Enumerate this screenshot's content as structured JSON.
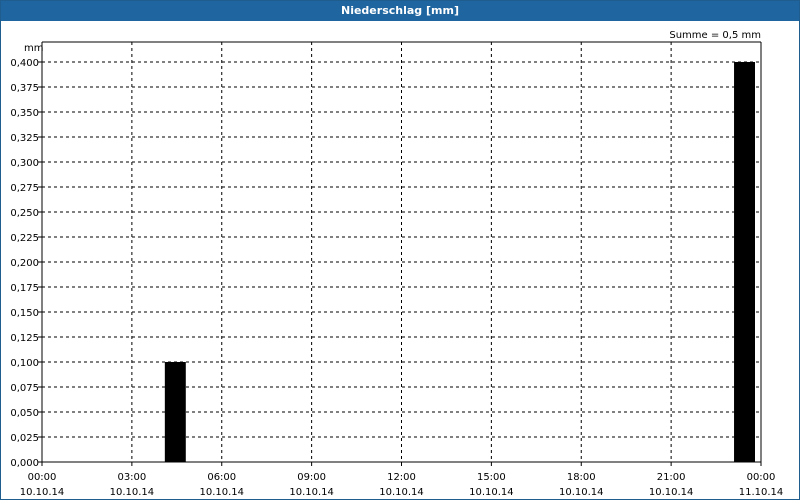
{
  "window": {
    "title": "Niederschlag [mm]"
  },
  "chart_data": {
    "type": "bar",
    "title": "Niederschlag [mm]",
    "ylabel": "mm",
    "annotation": "Summe = 0,5 mm",
    "ylim": [
      0,
      0.4
    ],
    "grid": true,
    "y_ticks": [
      "0,000",
      "0,025",
      "0,050",
      "0,075",
      "0,100",
      "0,125",
      "0,150",
      "0,175",
      "0,200",
      "0,225",
      "0,250",
      "0,275",
      "0,300",
      "0,325",
      "0,350",
      "0,375",
      "0,400"
    ],
    "x_ticks": [
      {
        "time": "00:00",
        "date": "10.10.14"
      },
      {
        "time": "03:00",
        "date": "10.10.14"
      },
      {
        "time": "06:00",
        "date": "10.10.14"
      },
      {
        "time": "09:00",
        "date": "10.10.14"
      },
      {
        "time": "12:00",
        "date": "10.10.14"
      },
      {
        "time": "15:00",
        "date": "10.10.14"
      },
      {
        "time": "18:00",
        "date": "10.10.14"
      },
      {
        "time": "21:00",
        "date": "10.10.14"
      },
      {
        "time": "00:00",
        "date": "11.10.14"
      }
    ],
    "xlim": [
      "10.10.14 00:00",
      "11.10.14 00:00"
    ],
    "bars": [
      {
        "start": "10.10.14 04:00",
        "end": "10.10.14 05:00",
        "value": 0.1
      },
      {
        "start": "10.10.14 23:00",
        "end": "11.10.14 00:00",
        "value": 0.4
      }
    ],
    "colors": {
      "bar": "#000000",
      "grid": "#000000",
      "titlebar": "#1f66a0"
    }
  }
}
